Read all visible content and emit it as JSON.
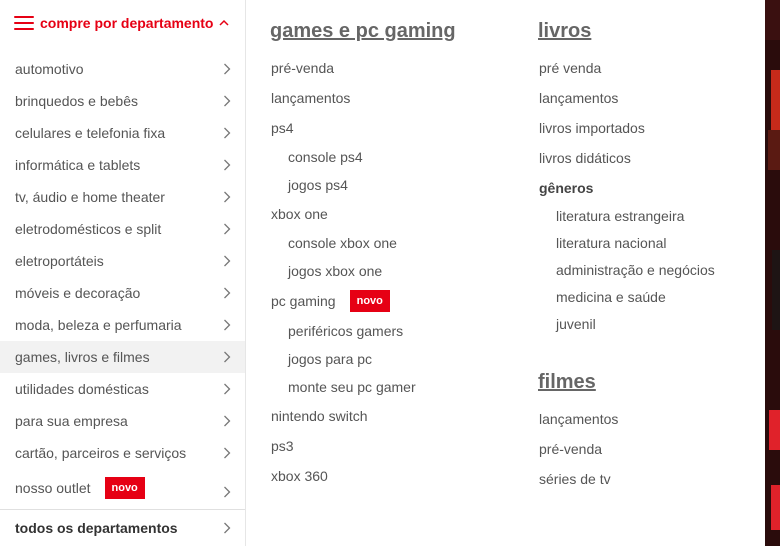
{
  "menu": {
    "header_label": "compre por departamento",
    "departments": [
      {
        "label": "automotivo"
      },
      {
        "label": "brinquedos e bebês"
      },
      {
        "label": "celulares e telefonia fixa"
      },
      {
        "label": "informática e tablets"
      },
      {
        "label": "tv, áudio e home theater"
      },
      {
        "label": "eletrodomésticos e split"
      },
      {
        "label": "eletroportáteis"
      },
      {
        "label": "móveis e decoração"
      },
      {
        "label": "moda, beleza e perfumaria"
      },
      {
        "label": "games, livros e filmes"
      },
      {
        "label": "utilidades domésticas"
      },
      {
        "label": "para sua empresa"
      },
      {
        "label": "cartão, parceiros e serviços"
      },
      {
        "label": "nosso outlet",
        "badge": "novo"
      }
    ],
    "all_departments_label": "todos os departamentos",
    "active_department": "games, livros e filmes"
  },
  "games_column": {
    "title": "games e pc gaming",
    "links": {
      "pre_venda": "pré-venda",
      "lancamentos": "lançamentos",
      "ps4": "ps4",
      "console_ps4": "console ps4",
      "jogos_ps4": "jogos ps4",
      "xbox_one": "xbox one",
      "console_xbox_one": "console xbox one",
      "jogos_xbox_one": "jogos xbox one",
      "pc_gaming": "pc gaming",
      "pc_gaming_badge": "novo",
      "perifericos_gamers": "periféricos gamers",
      "jogos_para_pc": "jogos para pc",
      "monte_seu_pc_gamer": "monte seu pc gamer",
      "nintendo_switch": "nintendo switch",
      "ps3": "ps3",
      "xbox_360": "xbox 360"
    }
  },
  "livros_column": {
    "title": "livros",
    "links": {
      "pre_venda": "pré venda",
      "lancamentos": "lançamentos",
      "livros_importados": "livros importados",
      "livros_didaticos": "livros didáticos",
      "generos_heading": "gêneros",
      "literatura_estrangeira": "literatura estrangeira",
      "literatura_nacional": "literatura nacional",
      "administracao": "administração e negócios",
      "medicina": "medicina e saúde",
      "juvenil": "juvenil"
    }
  },
  "filmes_column": {
    "title": "filmes",
    "links": {
      "lancamentos": "lançamentos",
      "pre_venda": "pré-venda",
      "series_de_tv": "séries de tv"
    }
  },
  "colors": {
    "accent": "#e60014",
    "text": "#555555",
    "active_bg": "#f2f2f2"
  }
}
